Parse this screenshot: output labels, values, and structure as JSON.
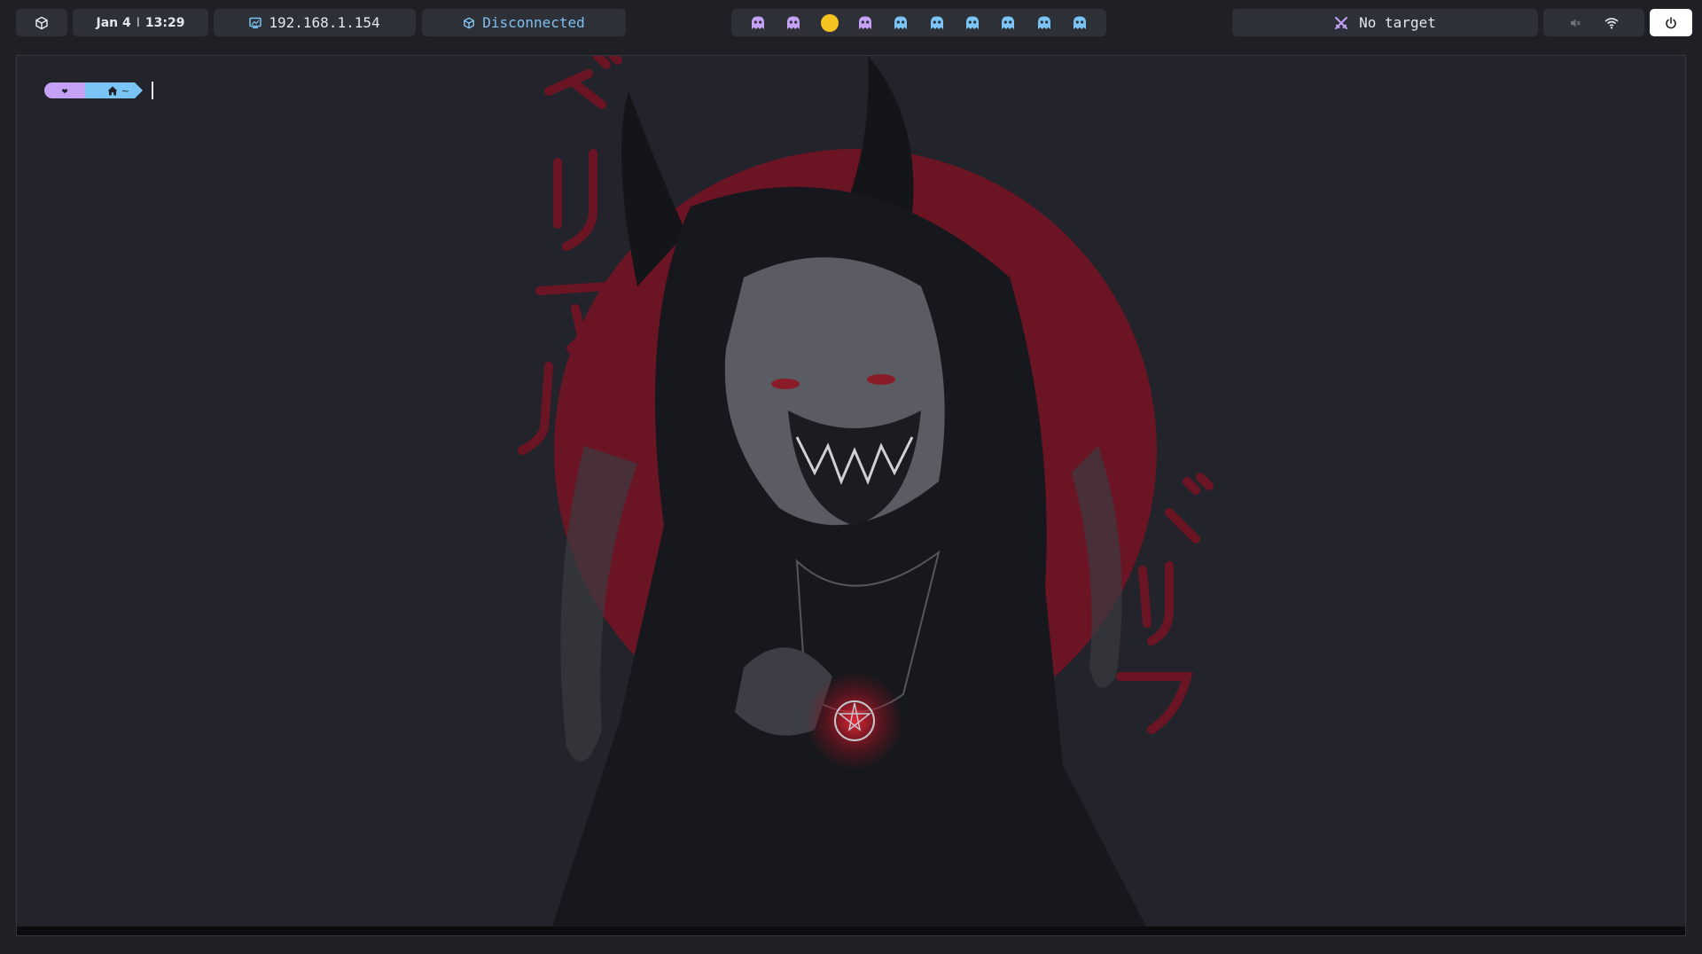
{
  "topbar": {
    "date": "Jan 4",
    "time": "13:29",
    "time_separator": "I",
    "ip_address": "192.168.1.154",
    "vpn_status": "Disconnected",
    "target": "No target",
    "workspaces": [
      {
        "id": 1,
        "color": "#c5a1f5",
        "active": false
      },
      {
        "id": 2,
        "color": "#c5a1f5",
        "active": false
      },
      {
        "id": 3,
        "color": "#f6c321",
        "active": true
      },
      {
        "id": 4,
        "color": "#c5a1f5",
        "active": false
      },
      {
        "id": 5,
        "color": "#79c3f5",
        "active": false
      },
      {
        "id": 6,
        "color": "#79c3f5",
        "active": false
      },
      {
        "id": 7,
        "color": "#79c3f5",
        "active": false
      },
      {
        "id": 8,
        "color": "#79c3f5",
        "active": false
      },
      {
        "id": 9,
        "color": "#79c3f5",
        "active": false
      },
      {
        "id": 10,
        "color": "#79c3f5",
        "active": false
      }
    ],
    "icons": {
      "menu": "cube-icon",
      "ip": "monitor-icon",
      "vpn": "cube-icon",
      "target": "crossed-swords-icon",
      "volume": "muted-speaker-icon",
      "wifi": "wifi-icon",
      "power": "power-icon"
    }
  },
  "terminal": {
    "prompt_heart": "❤",
    "prompt_dir": "~",
    "prompt_colors": {
      "heart": "#c5a1f5",
      "dir": "#79c3f5"
    }
  },
  "wallpaper": {
    "katakana_vertical": "ベリアル",
    "katakana_right": "ベリア"
  },
  "colors": {
    "background": "#1f2025",
    "pill": "#2e3038",
    "accent_red": "#6b1424",
    "vpn_text": "#7dc0f0"
  }
}
